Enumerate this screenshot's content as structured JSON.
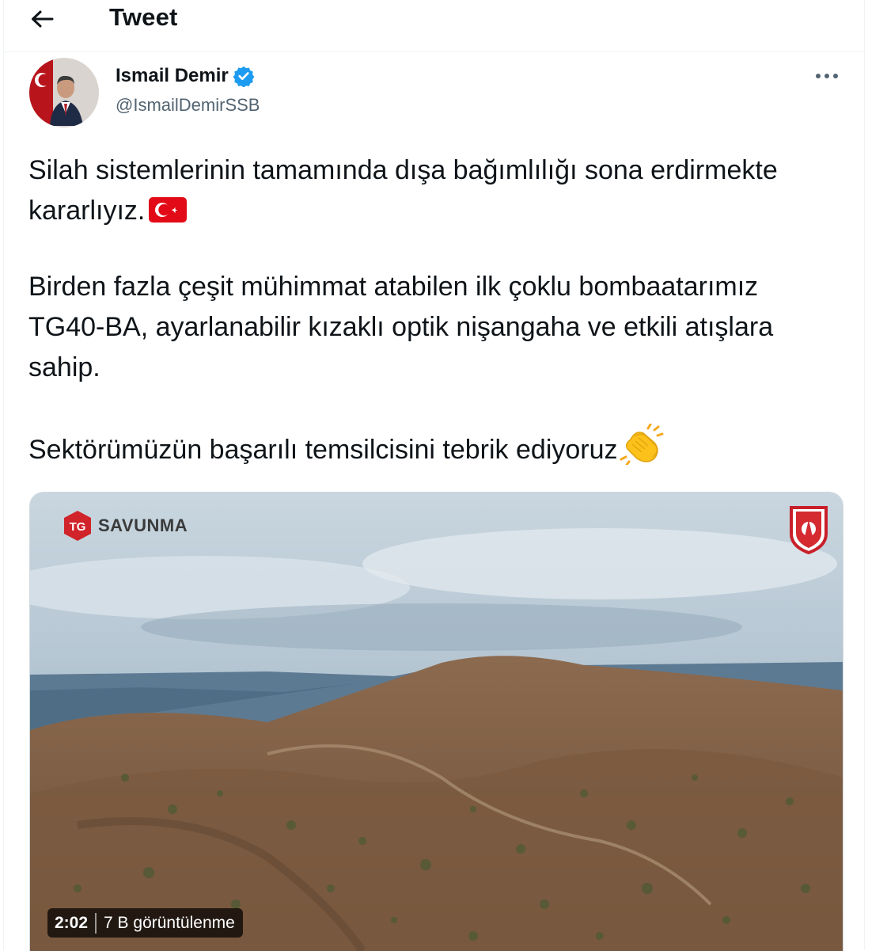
{
  "header": {
    "title": "Tweet"
  },
  "author": {
    "display_name": "Ismail Demir",
    "handle": "@IsmailDemirSSB",
    "verified": true
  },
  "tweet": {
    "paragraphs": [
      "Silah sistemlerinin tamamında dışa bağımlılığı sona erdirmekte kararlıyız.",
      "Birden fazla çeşit mühimmat atabilen ilk çoklu bombaatarımız TG40-BA, ayarlanabilir kızaklı optik nişangaha ve etkili atışlara sahip.",
      "Sektörümüzün başarılı temsilcisini tebrik ediyoruz"
    ],
    "emojis": [
      "turkey-flag",
      "clapping-hands"
    ]
  },
  "media": {
    "watermark_left": "SAVUNMA",
    "logo_left_mark": "TG",
    "duration": "2:02",
    "views": "7 B görüntülenme"
  },
  "colors": {
    "verified": "#1d9bf0",
    "text": "#0f1419",
    "secondary": "#536471",
    "flag_red": "#e30a17"
  }
}
